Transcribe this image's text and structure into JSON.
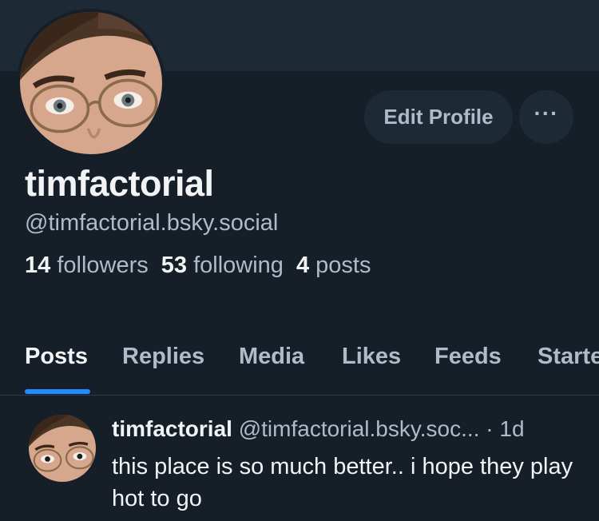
{
  "profile": {
    "display_name": "timfactorial",
    "handle": "@timfactorial.bsky.social",
    "followers_count": "14",
    "followers_label": "followers",
    "following_count": "53",
    "following_label": "following",
    "posts_count": "4",
    "posts_label": "posts"
  },
  "actions": {
    "edit_profile_label": "Edit Profile",
    "more_label": "···"
  },
  "tabs": [
    {
      "label": "Posts",
      "active": true
    },
    {
      "label": "Replies",
      "active": false
    },
    {
      "label": "Media",
      "active": false
    },
    {
      "label": "Likes",
      "active": false
    },
    {
      "label": "Feeds",
      "active": false
    },
    {
      "label": "Starte",
      "active": false
    }
  ],
  "feed": [
    {
      "author_name": "timfactorial",
      "author_handle": "@timfactorial.bsky.soc...",
      "separator": "·",
      "time": "1d",
      "text": "this place is so much better.. i hope they play hot to go"
    }
  ],
  "colors": {
    "background": "#161e27",
    "banner": "#1e2936",
    "accent": "#208bfe",
    "muted_text": "#aebbc9"
  },
  "icons": {
    "more": "ellipsis-icon",
    "avatar": "profile-photo"
  }
}
